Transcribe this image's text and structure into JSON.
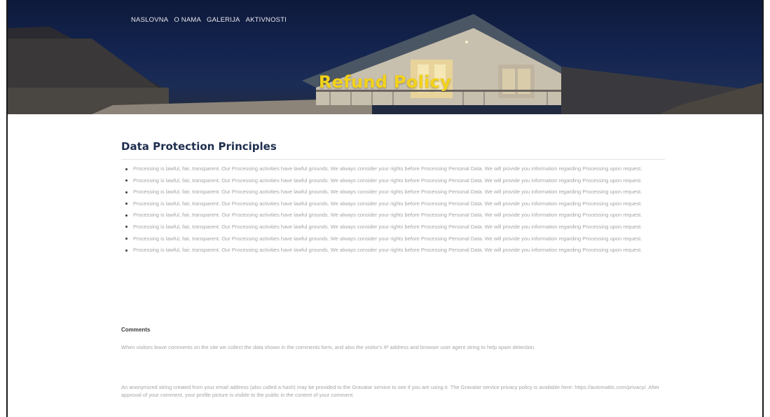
{
  "nav": {
    "items": [
      {
        "label": "NASLOVNA"
      },
      {
        "label": "O NAMA"
      },
      {
        "label": "GALERIJA"
      },
      {
        "label": "AKTIVNOSTI"
      }
    ]
  },
  "hero": {
    "title": "Refund Policy",
    "title_color": "#f3d21a"
  },
  "section": {
    "title": "Data Protection Principles",
    "principles": [
      {
        "text": "Processing is lawful, fair, transparent. Our Processing activities have lawful grounds. We always consider your rights before Processing Personal Data. We will provide you information regarding Processing upon request."
      },
      {
        "text": "Processing is lawful, fair, transparent. Our Processing activities have lawful grounds. We always consider your rights before Processing Personal Data. We will provide you information regarding Processing upon request."
      },
      {
        "text": "Processing is lawful, fair, transparent. Our Processing activities have lawful grounds. We always consider your rights before Processing Personal Data. We will provide you information regarding Processing upon request."
      },
      {
        "text": "Processing is lawful, fair, transparent. Our Processing activities have lawful grounds. We always consider your rights before Processing Personal Data. We will provide you information regarding Processing upon request."
      },
      {
        "text": "Processing is lawful, fair, transparent. Our Processing activities have lawful grounds. We always consider your rights before Processing Personal Data. We will provide you information regarding Processing upon request."
      },
      {
        "text": "Processing is lawful, fair, transparent. Our Processing activities have lawful grounds. We always consider your rights before Processing Personal Data. We will provide you information regarding Processing upon request."
      },
      {
        "text": "Processing is lawful, fair, transparent. Our Processing activities have lawful grounds. We always consider your rights before Processing Personal Data. We will provide you information regarding Processing upon request."
      },
      {
        "text": "Processing is lawful, fair, transparent. Our Processing activities have lawful grounds. We always consider your rights before Processing Personal Data. We will provide you information regarding Processing upon request."
      }
    ]
  },
  "comments": {
    "title": "Comments",
    "text": "When visitors leave comments on the site we collect the data shown in the comments form, and also the visitor's IP address and browser user agent string to help spam detection.",
    "gravatar_text": "An anonymized string created from your email address (also called a hash) may be provided to the Gravatar service to see if you are using it. The Gravatar service privacy policy is available here: https://automattic.com/privacy/. After approval of your comment, your profile picture is visible to the public in the context of your comment."
  }
}
